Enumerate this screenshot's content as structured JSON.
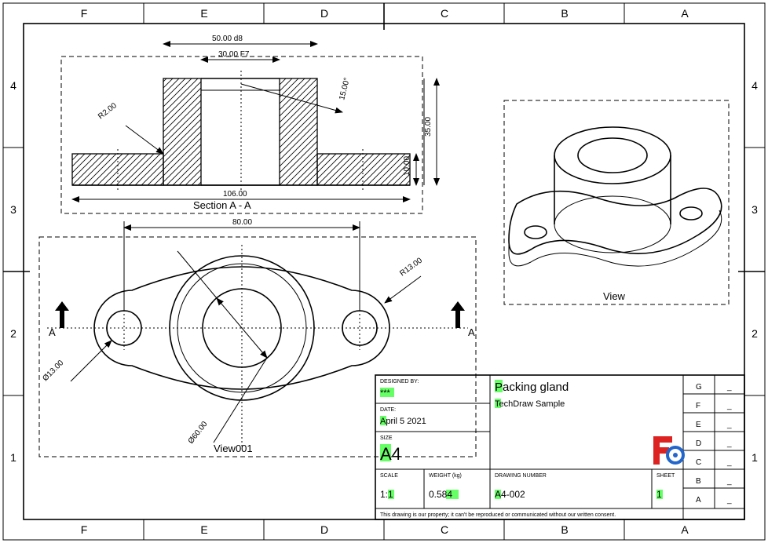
{
  "frame": {
    "cols": [
      "F",
      "E",
      "D",
      "C",
      "B",
      "A"
    ],
    "rows": [
      "1",
      "2",
      "3",
      "4"
    ]
  },
  "section": {
    "name": "Section A - A",
    "dims": {
      "top1": "50.00 d8",
      "top2": "30.00 F7",
      "angle": "15.00°",
      "h1": "10.00",
      "h2": "35.00",
      "width": "106.00",
      "rad": "R2.00"
    }
  },
  "top_view": {
    "name": "View001",
    "dims": {
      "centers": "80.00",
      "hole": "Ø13.00",
      "bore": "Ø60.00",
      "r_small": "R13.00"
    },
    "section_tag": "A"
  },
  "iso": {
    "name": "View"
  },
  "title_block": {
    "designed_by_lbl": "DESIGNED BY:",
    "designed_by": "***",
    "date_lbl": "DATE:",
    "date": "April 5 2021",
    "size_lbl": "SIZE",
    "size": "A4",
    "scale_lbl": "SCALE",
    "scale": "1:1",
    "weight_lbl": "WEIGHT (kg)",
    "weight": "0.584",
    "dn_lbl": "DRAWING NUMBER",
    "dn": "A4-002",
    "sheet_lbl": "SHEET",
    "sheet": "1",
    "title": "Packing gland",
    "subtitle": "TechDraw Sample",
    "note": "This drawing is our property; it can't be reproduced or communicated without our written consent.",
    "rev_col": [
      "G",
      "F",
      "E",
      "D",
      "C",
      "B",
      "A"
    ],
    "rev_dash": "_"
  }
}
